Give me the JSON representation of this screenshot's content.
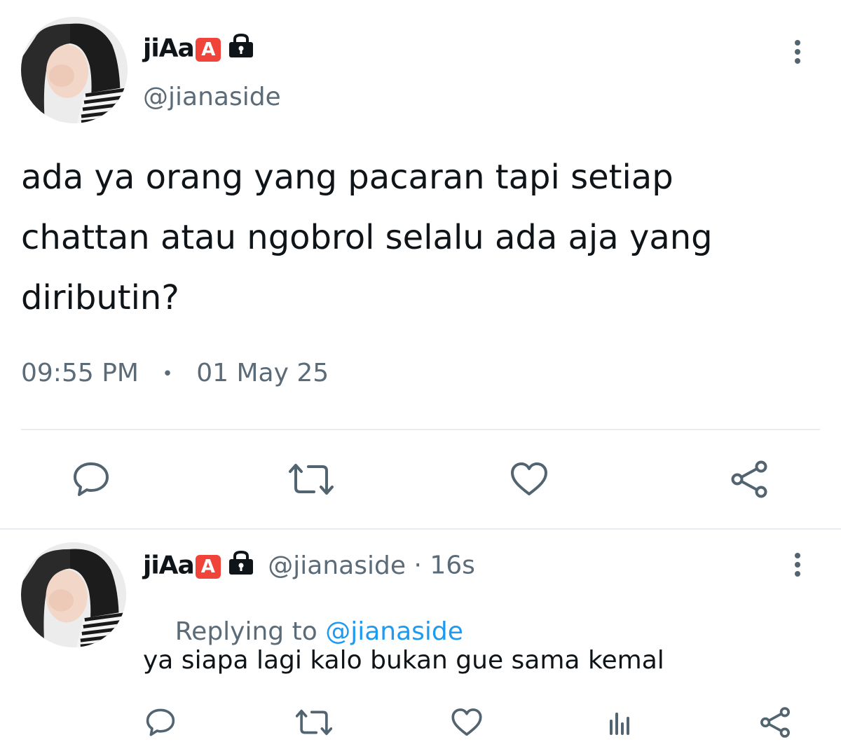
{
  "main_tweet": {
    "display_name": "jiAa",
    "badge": "A",
    "lock_icon": "lock-icon",
    "handle": "@jianaside",
    "text_line1": "ada ya orang yang pacaran tapi setiap",
    "text_line2": "chattan atau ngobrol selalu ada aja yang",
    "text_line3": "diributin?",
    "time": "09:55 PM",
    "dot": "•",
    "date": "01 May 25",
    "actions": [
      "reply-icon",
      "retweet-icon",
      "like-icon",
      "share-icon"
    ]
  },
  "reply_tweet": {
    "display_name": "jiAa",
    "badge": "A",
    "handle": "@jianaside",
    "separator": " · ",
    "age": "16s",
    "replying_prefix": "Replying to ",
    "replying_handle": "@jianaside",
    "text": "ya siapa lagi kalo bukan gue sama kemal",
    "actions": [
      "reply-icon",
      "retweet-icon",
      "like-icon",
      "analytics-icon",
      "share-icon"
    ]
  },
  "colors": {
    "text": "#0f1419",
    "secondary": "#5b6b78",
    "link": "#1d9bf0",
    "badge": "#f0443b",
    "divider": "#e6ecf0"
  }
}
